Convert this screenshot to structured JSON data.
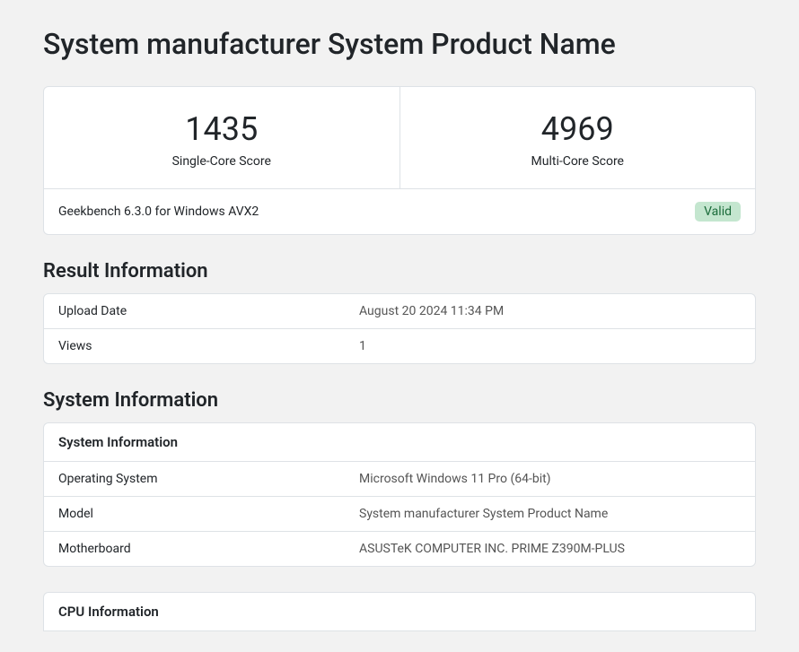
{
  "title": "System manufacturer System Product Name",
  "scores": {
    "single": {
      "value": "1435",
      "label": "Single-Core Score"
    },
    "multi": {
      "value": "4969",
      "label": "Multi-Core Score"
    }
  },
  "version_line": "Geekbench 6.3.0 for Windows AVX2",
  "valid_badge": "Valid",
  "result_info": {
    "heading": "Result Information",
    "rows": [
      {
        "key": "Upload Date",
        "val": "August 20 2024 11:34 PM"
      },
      {
        "key": "Views",
        "val": "1"
      }
    ]
  },
  "system_info": {
    "heading": "System Information",
    "card_header": "System Information",
    "rows": [
      {
        "key": "Operating System",
        "val": "Microsoft Windows 11 Pro (64-bit)"
      },
      {
        "key": "Model",
        "val": "System manufacturer System Product Name"
      },
      {
        "key": "Motherboard",
        "val": "ASUSTeK COMPUTER INC. PRIME Z390M-PLUS"
      }
    ]
  },
  "cpu_info": {
    "card_header": "CPU Information"
  }
}
